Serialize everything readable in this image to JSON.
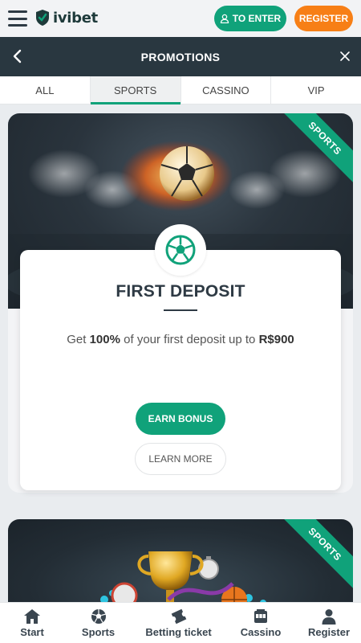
{
  "header": {
    "brand": "ivibet",
    "enter_label": "TO ENTER",
    "register_label": "REGISTER"
  },
  "promo_bar": {
    "title": "PROMOTIONS"
  },
  "tabs": [
    {
      "label": "ALL",
      "active": false
    },
    {
      "label": "SPORTS",
      "active": true
    },
    {
      "label": "CASSINO",
      "active": false
    },
    {
      "label": "VIP",
      "active": false
    }
  ],
  "promos": [
    {
      "ribbon": "SPORTS",
      "title": "FIRST DEPOSIT",
      "desc_prefix": "Get ",
      "desc_percent": "100%",
      "desc_middle": " of your first deposit up to ",
      "desc_amount": "R$900",
      "earn_label": "EARN BONUS",
      "learn_label": "LEARN MORE"
    },
    {
      "ribbon": "SPORTS"
    }
  ],
  "bottom_nav": [
    {
      "label": "Start",
      "icon": "home-icon"
    },
    {
      "label": "Sports",
      "icon": "soccer-ball-icon"
    },
    {
      "label": "Betting ticket",
      "icon": "ticket-icon"
    },
    {
      "label": "Cassino",
      "icon": "slot-machine-icon"
    },
    {
      "label": "Register",
      "icon": "user-icon"
    }
  ],
  "colors": {
    "accent_green": "#10a27a",
    "accent_orange": "#f77f16",
    "dark_bar": "#293740"
  }
}
